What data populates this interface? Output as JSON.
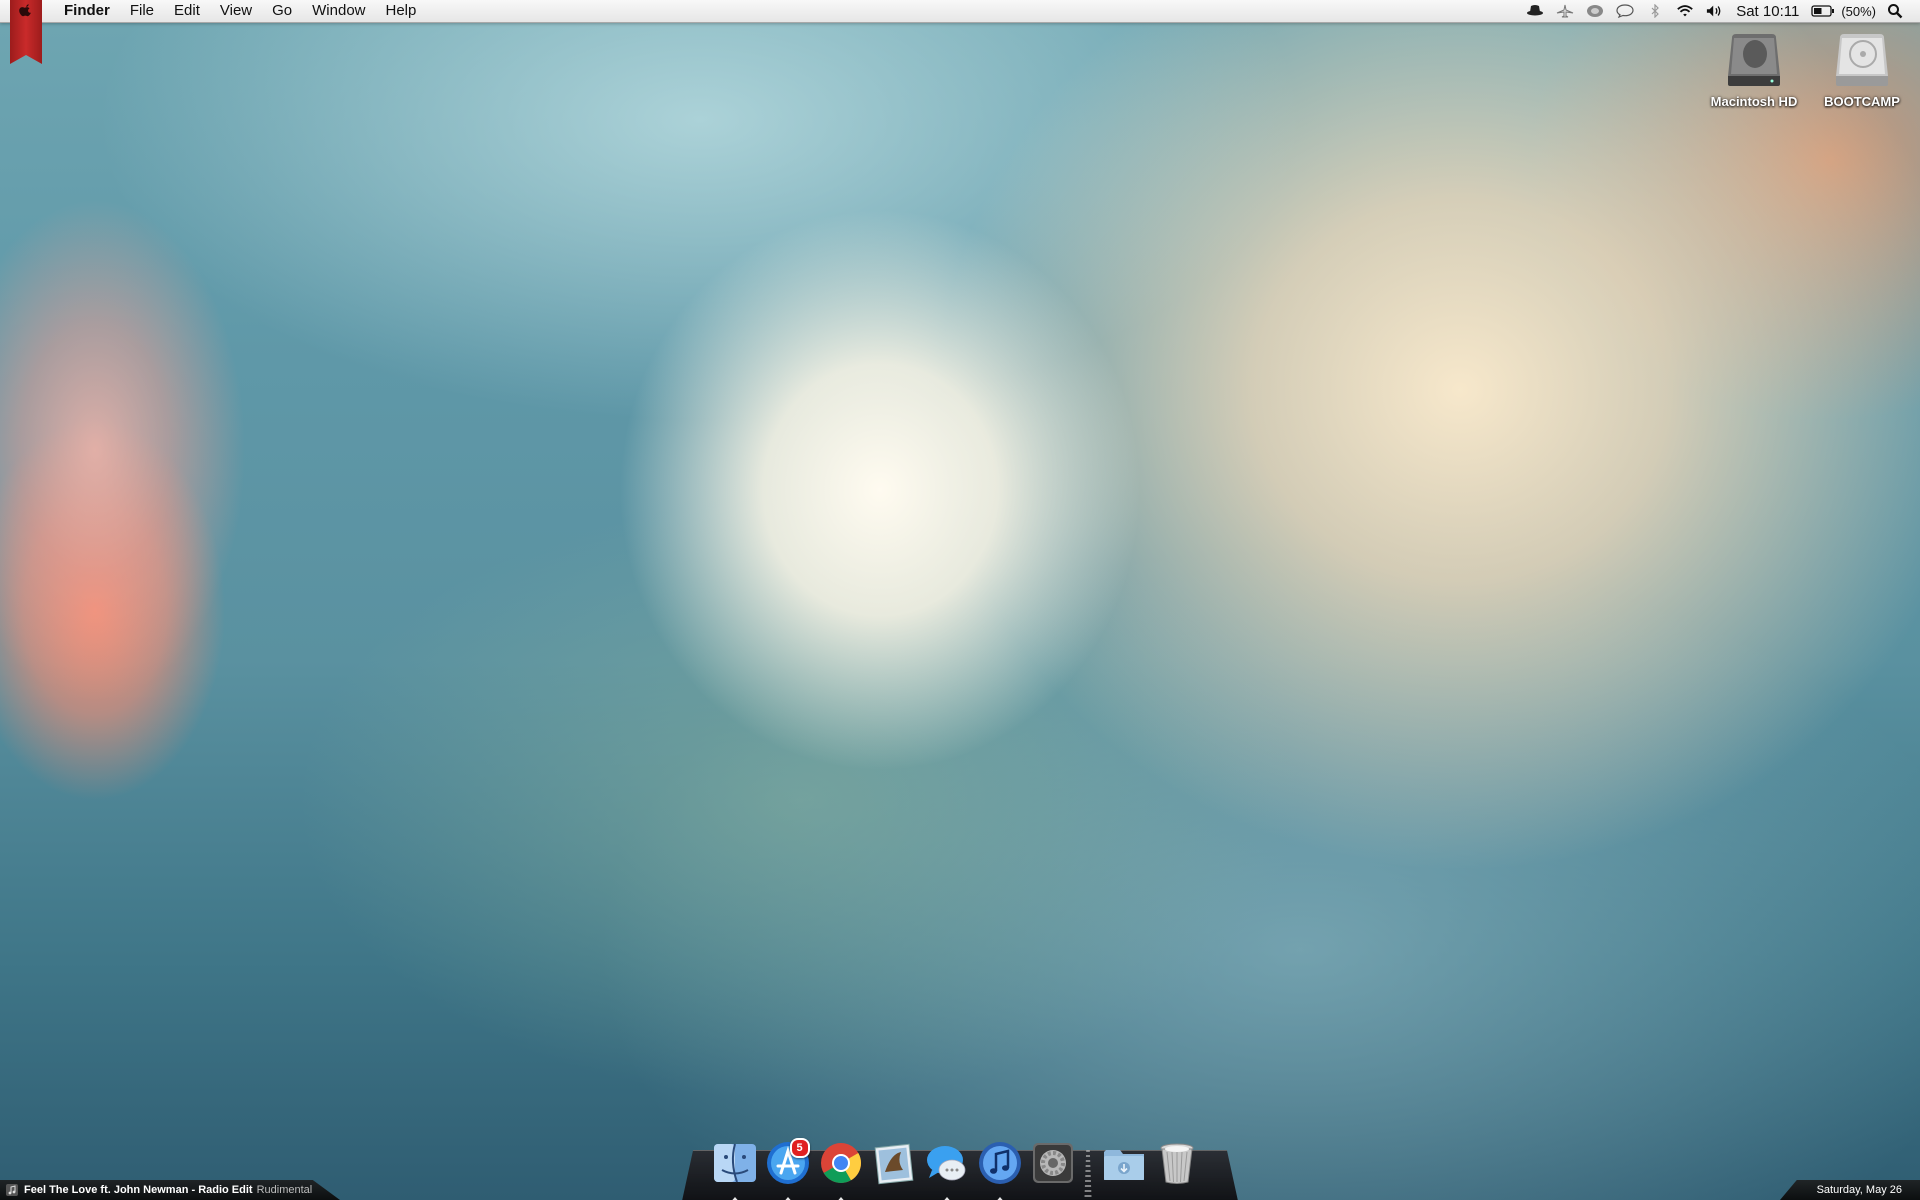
{
  "menubar": {
    "app_name": "Finder",
    "menus": [
      "File",
      "Edit",
      "View",
      "Go",
      "Window",
      "Help"
    ],
    "status_icons": [
      "incognito-hat-icon",
      "airplane-icon",
      "sync-icon",
      "chat-icon",
      "bluetooth-icon",
      "wifi-icon",
      "volume-icon"
    ],
    "clock": "Sat 10:11",
    "battery_percent": "(50%)",
    "battery_level": 0.5
  },
  "desktop_icons": [
    {
      "label": "Macintosh HD",
      "icon": "hard-drive-icon"
    },
    {
      "label": "BOOTCAMP",
      "icon": "bootcamp-drive-icon"
    }
  ],
  "dock": {
    "items": [
      {
        "name": "Finder",
        "icon": "finder-icon",
        "running": true
      },
      {
        "name": "App Store",
        "icon": "app-store-icon",
        "running": true,
        "badge": "5"
      },
      {
        "name": "Google Chrome",
        "icon": "chrome-icon",
        "running": true
      },
      {
        "name": "Mail",
        "icon": "mail-icon",
        "running": false
      },
      {
        "name": "Messages",
        "icon": "messages-icon",
        "running": true
      },
      {
        "name": "iTunes",
        "icon": "itunes-icon",
        "running": true
      },
      {
        "name": "System Preferences",
        "icon": "system-preferences-icon",
        "running": false
      }
    ],
    "stacks": [
      {
        "name": "Downloads",
        "icon": "downloads-folder-icon"
      },
      {
        "name": "Trash",
        "icon": "trash-icon"
      }
    ]
  },
  "now_playing": {
    "track": "Feel The Love ft. John Newman - Radio Edit",
    "artist": "Rudimental"
  },
  "date_bar": {
    "date": "Saturday, May 26"
  },
  "colors": {
    "ribbon": "#c92a2a",
    "badge": "#e02020",
    "desktop_teal": "#5f98a8"
  }
}
